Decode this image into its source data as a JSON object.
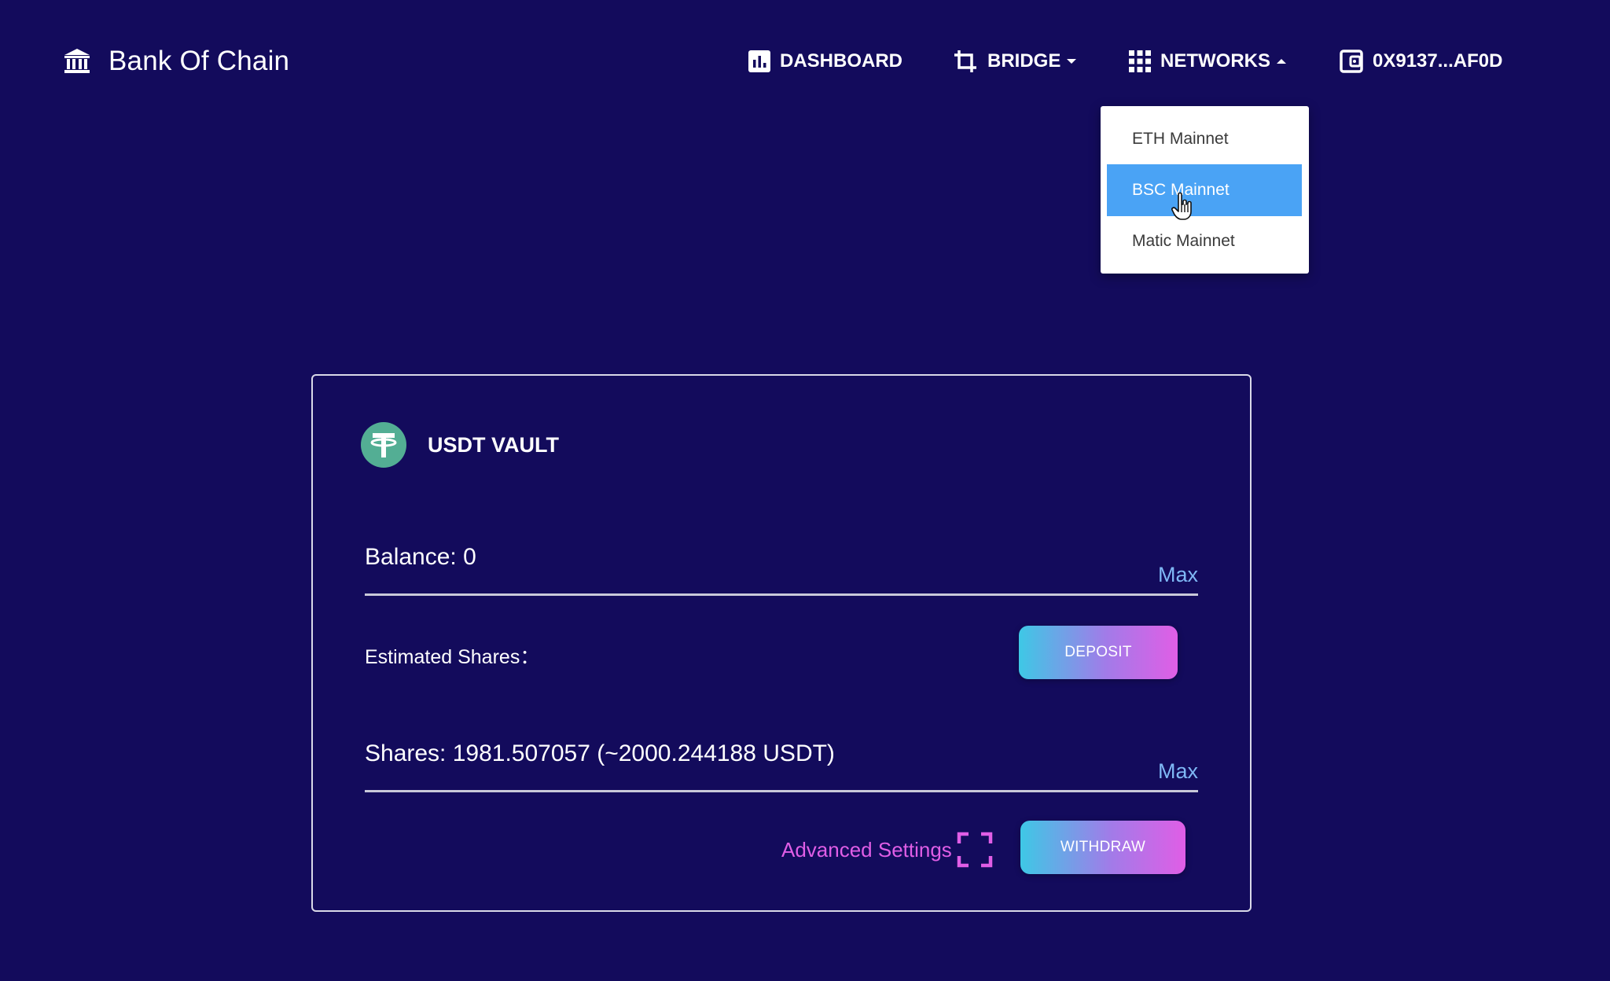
{
  "header": {
    "brand_title": "Bank Of Chain",
    "brand_icon": "bank-icon",
    "nav": {
      "dashboard": {
        "label": "DASHBOARD",
        "icon": "bar-chart-icon"
      },
      "bridge": {
        "label": "BRIDGE",
        "icon": "crop-icon"
      },
      "networks": {
        "label": "NETWORKS",
        "icon": "grid-icon"
      },
      "wallet": {
        "label": "0X9137...AF0D",
        "icon": "wallet-icon"
      }
    }
  },
  "networks_dropdown": {
    "items": [
      {
        "label": "ETH Mainnet"
      },
      {
        "label": "BSC Mainnet"
      },
      {
        "label": "Matic Mainnet"
      }
    ],
    "selected_index": 1,
    "highlight_color": "#4aa3f5"
  },
  "vault": {
    "title": "USDT VAULT",
    "icon": "usdt-icon",
    "balance_text": "Balance: 0",
    "max_label": "Max",
    "estimated_shares_label": "Estimated Shares：",
    "deposit_label": "DEPOSIT",
    "shares_text": "Shares: 1981.507057 (~2000.244188 USDT)",
    "advanced_settings_label": "Advanced Settings",
    "withdraw_label": "WITHDRAW"
  },
  "colors": {
    "background": "#130b5c",
    "accent_blue": "#7fb8f5",
    "accent_pink": "#e05ee6",
    "usdt_green": "#53ae94"
  }
}
